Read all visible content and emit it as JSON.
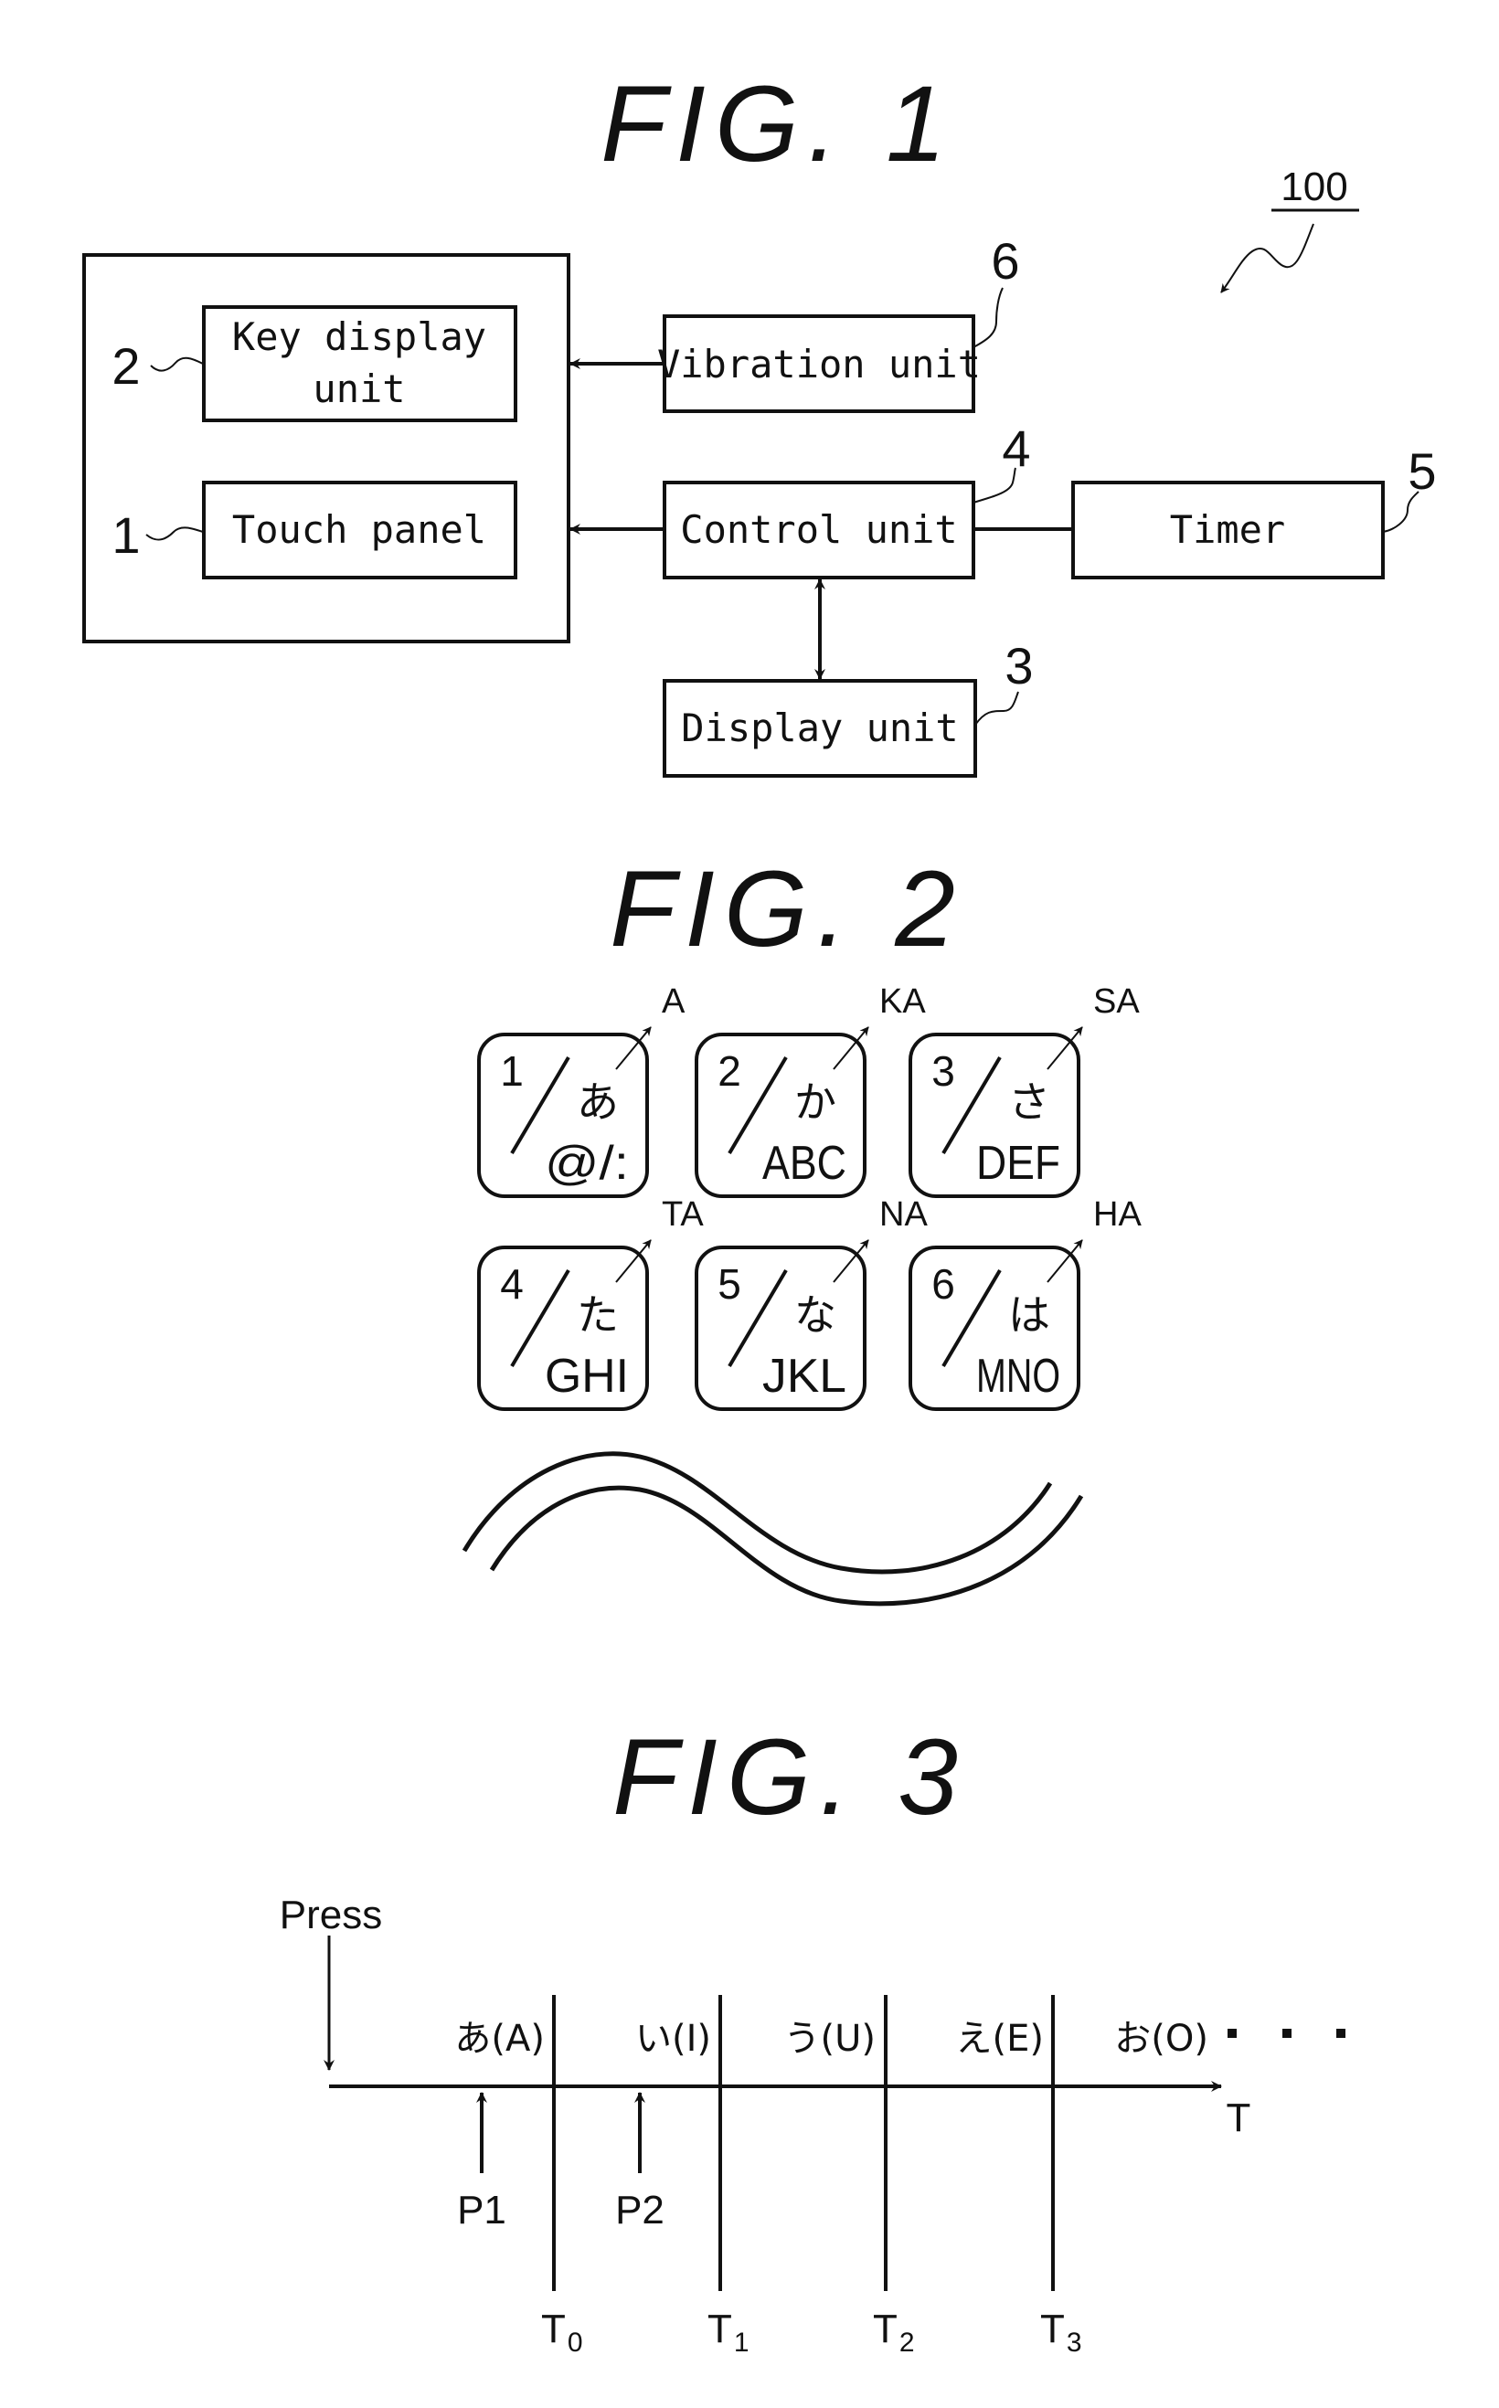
{
  "fig1": {
    "title": "FIG. 1",
    "system_ref": "100",
    "blocks": {
      "key_display": {
        "label_line1": "Key display",
        "label_line2": "unit",
        "ref": "2"
      },
      "touch_panel": {
        "label": "Touch panel",
        "ref": "1"
      },
      "vibration_unit": {
        "label": "Vibration unit",
        "ref": "6"
      },
      "control_unit": {
        "label": "Control unit",
        "ref": "4"
      },
      "timer": {
        "label": "Timer",
        "ref": "5"
      },
      "display_unit": {
        "label": "Display unit",
        "ref": "3"
      }
    }
  },
  "fig2": {
    "title": "FIG. 2",
    "keys": [
      {
        "num": "1",
        "kana": "あ",
        "alpha": "@/:",
        "label": "A"
      },
      {
        "num": "2",
        "kana": "か",
        "alpha": "ABC",
        "label": "KA"
      },
      {
        "num": "3",
        "kana": "さ",
        "alpha": "DEF",
        "label": "SA"
      },
      {
        "num": "4",
        "kana": "た",
        "alpha": "GHI",
        "label": "TA"
      },
      {
        "num": "5",
        "kana": "な",
        "alpha": "JKL",
        "label": "NA"
      },
      {
        "num": "6",
        "kana": "は",
        "alpha": "MNO",
        "label": "HA"
      }
    ]
  },
  "fig3": {
    "title": "FIG. 3",
    "press_label": "Press",
    "axis_label": "T",
    "characters": [
      "あ(A)",
      "い(I)",
      "う(U)",
      "え(E)",
      "お(O)"
    ],
    "ellipsis": "・・・",
    "time_marks": [
      {
        "main": "T",
        "sub": "0"
      },
      {
        "main": "T",
        "sub": "1"
      },
      {
        "main": "T",
        "sub": "2"
      },
      {
        "main": "T",
        "sub": "3"
      }
    ],
    "presses": [
      "P1",
      "P2"
    ]
  }
}
